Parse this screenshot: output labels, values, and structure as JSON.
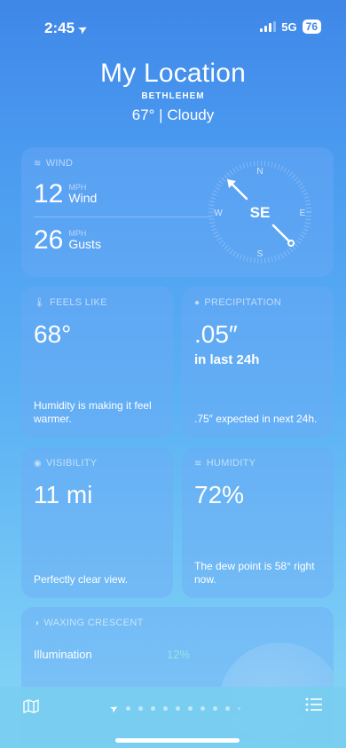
{
  "status": {
    "time": "2:45",
    "network": "5G",
    "battery": "76"
  },
  "header": {
    "title": "My Location",
    "subtitle": "BETHLEHEM",
    "conditions": "67°  |  Cloudy"
  },
  "wind": {
    "heading": "WIND",
    "speed": "12",
    "speed_unit": "MPH",
    "speed_label": "Wind",
    "gusts": "26",
    "gusts_unit": "MPH",
    "gusts_label": "Gusts",
    "direction": "SE",
    "compass": {
      "n": "N",
      "e": "E",
      "s": "S",
      "w": "W"
    }
  },
  "feels_like": {
    "heading": "FEELS LIKE",
    "value": "68°",
    "description": "Humidity is making it feel warmer."
  },
  "precipitation": {
    "heading": "PRECIPITATION",
    "value": ".05″",
    "period": "in last 24h",
    "description": ".75″ expected in next 24h."
  },
  "visibility": {
    "heading": "VISIBILITY",
    "value": "11 mi",
    "description": "Perfectly clear view."
  },
  "humidity": {
    "heading": "HUMIDITY",
    "value": "72%",
    "description": "The dew point is 58° right now."
  },
  "moon": {
    "heading": "WAXING CRESCENT",
    "illumination_label": "Illumination",
    "illumination_value": "12%"
  },
  "icons": {
    "location_arrow": "location-arrow-icon",
    "wind": "wind-icon",
    "thermometer": "thermometer-icon",
    "drop": "drop-icon",
    "eye": "eye-icon",
    "humidity": "humidity-icon",
    "moon": "moon-icon",
    "map": "map-icon",
    "list": "list-icon"
  }
}
